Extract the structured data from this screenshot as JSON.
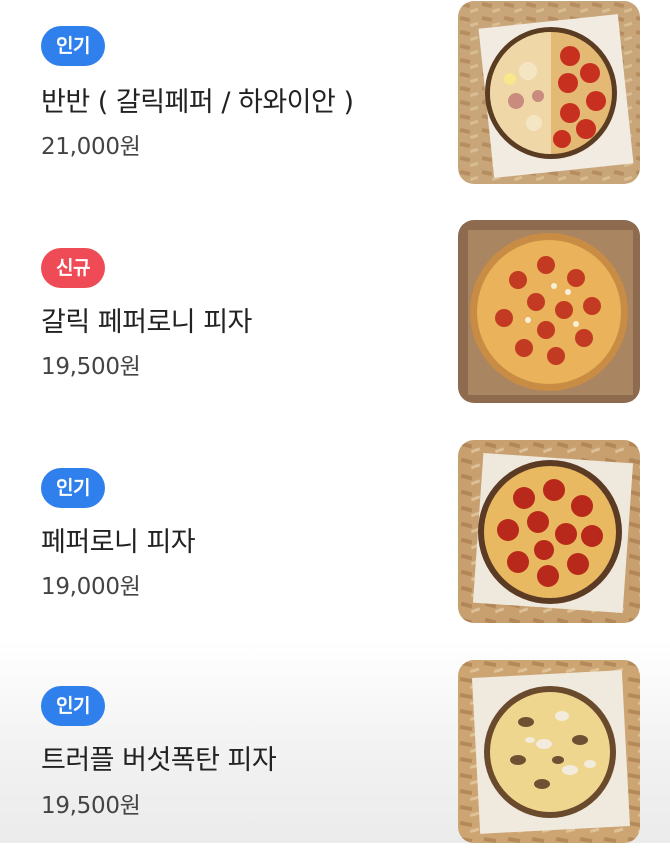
{
  "menu": {
    "items": [
      {
        "badge": "인기",
        "badge_color": "#2f80ed",
        "name": "반반 ( 갈릭페퍼 / 하와이안 )",
        "price": "21,000원",
        "image_icon": "pizza-half-half-photo"
      },
      {
        "badge": "신규",
        "badge_color": "#ef4b57",
        "name": "갈릭 페퍼로니 피자",
        "price": "19,500원",
        "image_icon": "garlic-pepperoni-pizza-photo"
      },
      {
        "badge": "인기",
        "badge_color": "#2f80ed",
        "name": "페퍼로니 피자",
        "price": "19,000원",
        "image_icon": "pepperoni-pizza-photo"
      },
      {
        "badge": "인기",
        "badge_color": "#2f80ed",
        "name": "트러플 버섯폭탄 피자",
        "price": "19,500원",
        "image_icon": "truffle-mushroom-pizza-photo"
      }
    ]
  }
}
